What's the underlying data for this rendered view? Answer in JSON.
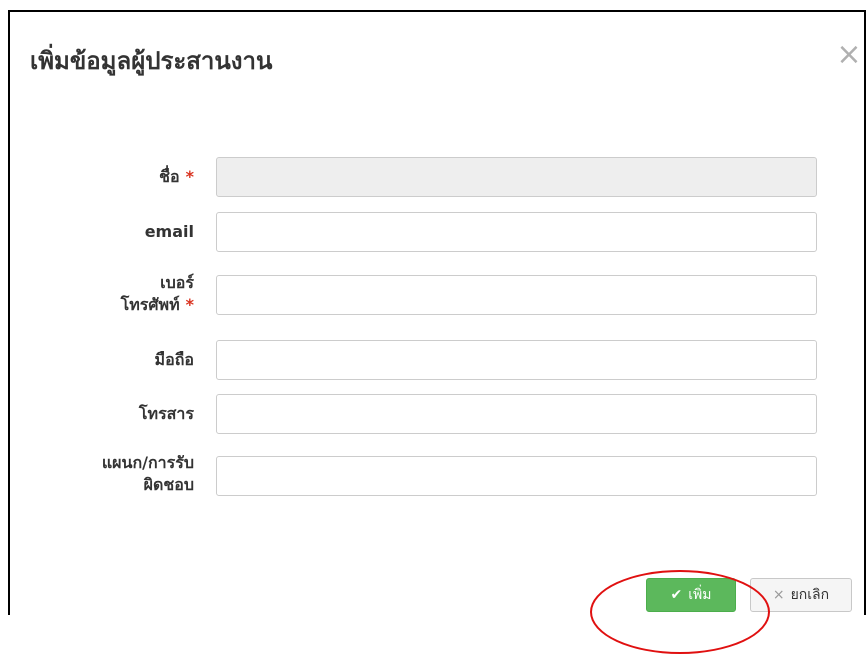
{
  "dialog": {
    "title": "เพิ่มข้อมูลผู้ประสานงาน",
    "close_glyph": "×"
  },
  "form": {
    "name": {
      "label": "ชื่อ",
      "required_mark": "*",
      "value": ""
    },
    "email": {
      "label": "email",
      "value": ""
    },
    "phone": {
      "label_line1": "เบอร์",
      "label_line2": "โทรศัพท์",
      "required_mark": "*",
      "value": ""
    },
    "mobile": {
      "label": "มือถือ",
      "value": ""
    },
    "fax": {
      "label": "โทรสาร",
      "value": ""
    },
    "department": {
      "label_line1": "แผนก/การรับ",
      "label_line2": "ผิดชอบ",
      "value": ""
    }
  },
  "buttons": {
    "add": {
      "icon": "check-icon",
      "glyph": "✔",
      "label": "เพิ่ม"
    },
    "cancel": {
      "icon": "close-icon",
      "glyph": "×",
      "label": "ยกเลิก"
    }
  },
  "colors": {
    "add_button": "#5cb85c",
    "required_mark": "#d9321f",
    "annotation": "#e01010"
  }
}
